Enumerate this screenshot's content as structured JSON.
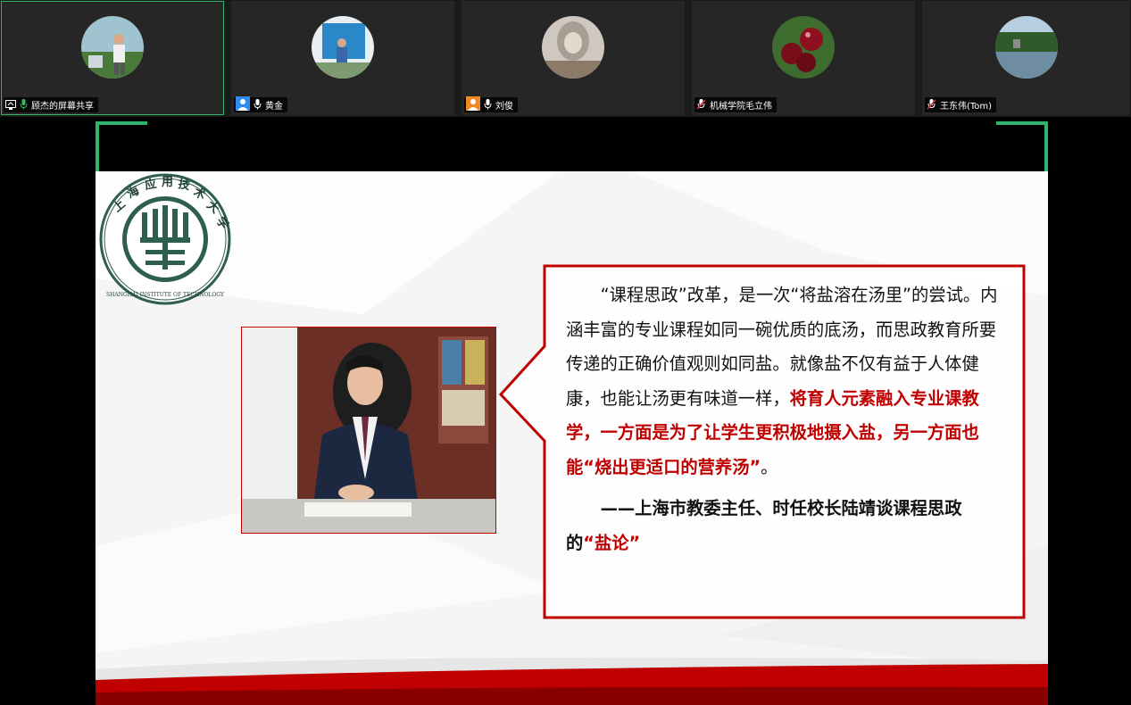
{
  "participants": [
    {
      "name": "顾杰的屏幕共享",
      "status_icon": "screen-share-icon",
      "mic": "mic-on-icon",
      "active": true
    },
    {
      "name": "黄金",
      "status_icon": "user-icon",
      "mic": "mic-on-icon",
      "active": false
    },
    {
      "name": "刘俊",
      "status_icon": "user-icon",
      "mic": "mic-on-icon",
      "active": false
    },
    {
      "name": "机械学院毛立伟",
      "status_icon": "",
      "mic": "mic-muted-icon",
      "active": false
    },
    {
      "name": "王东伟(Tom)",
      "status_icon": "",
      "mic": "mic-muted-icon",
      "active": false
    }
  ],
  "slide": {
    "logo_text_top": "上海应用技术大学",
    "logo_text_bottom": "SHANGHAI INSTITUTE OF TECHNOLOGY",
    "quote_intro": "“课程思政”改革，是一次“将盐溶在汤里”的尝试。内涵丰富的专业课程如同一碗优质的底汤，而思政教育所要传递的正确价值观则如同盐。就像盐不仅有益于人体健康，也能让汤更有味道一样，",
    "quote_red": "将育人元素融入专业课教学，一方面是为了让学生更积极地摄入盐，另一方面也能“烧出更适口的营养汤”",
    "quote_end": "。",
    "attribution": "——上海市教委主任、时任校长陆靖谈课程思政的",
    "attribution_red": "“盐论”"
  },
  "colors": {
    "accent_red": "#c00000",
    "active_border": "#2fb36d",
    "logo_green": "#2e5e4e"
  }
}
